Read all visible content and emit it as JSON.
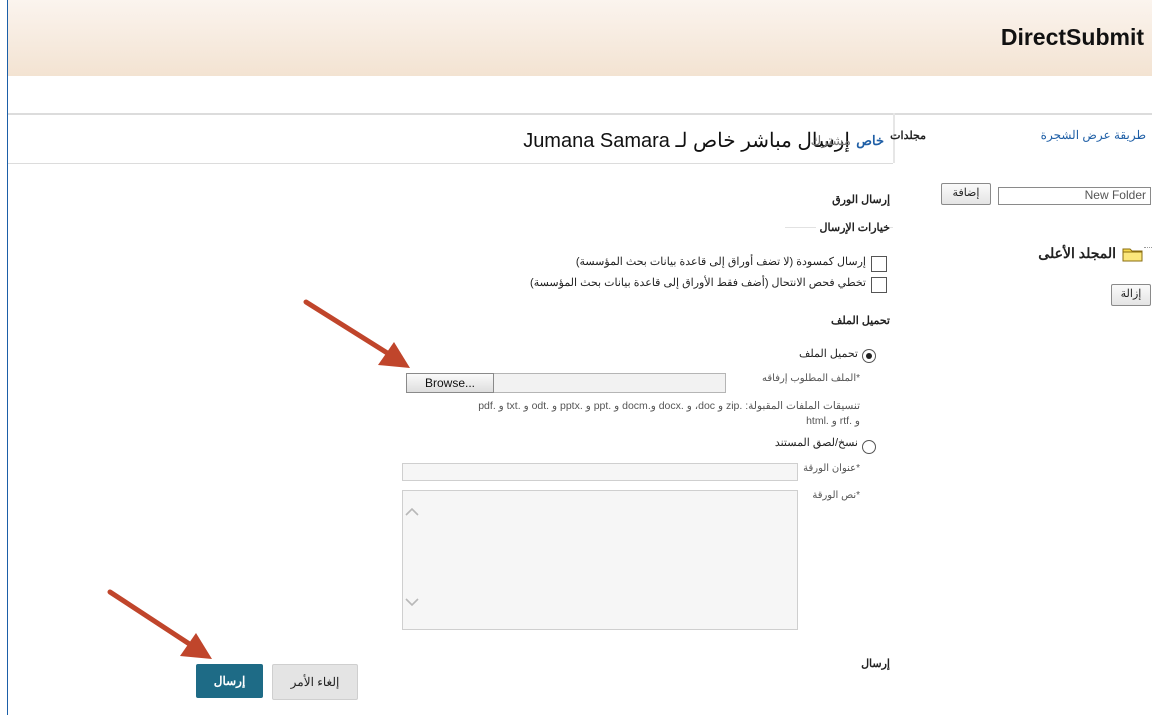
{
  "app": {
    "title": "DirectSubmit"
  },
  "header": {
    "heading": "إرسال مباشر خاص لـ Jumana Samara",
    "tab_private": "خاص",
    "tab_shared": "مشترك",
    "folders_label": "مجلدات",
    "tree_view_link": "طريقة عرض الشجرة"
  },
  "folders": {
    "new_folder_value": "New Folder",
    "add_label": "إضافة",
    "top_folder_label": "المجلد الأعلى",
    "remove_label": "إزالة"
  },
  "form": {
    "submit_paper_heading": "إرسال الورق",
    "submit_options_heading": "خيارات الإرسال",
    "option_draft": "إرسال كمسودة (لا تضف أوراق إلى قاعدة بيانات بحث المؤسسة)",
    "option_skip_plagiarism": "تخطي فحص الانتحال (أضف فقط الأوراق إلى قاعدة بيانات بحث المؤسسة)",
    "file_upload_heading": "تحميل الملف",
    "radio_upload_label": "تحميل الملف",
    "required_file_label": "*الملف المطلوب إرفاقه",
    "browse_label": "Browse...",
    "accepted_formats_line1": "تنسيقات الملفات المقبولة: .zip و doc، و .docx و.docm و .ppt و .pptx و .odt و .txt و .pdf",
    "accepted_formats_line2": "و .rtf و .html",
    "radio_paste_label": "نسخ/لصق المستند",
    "paper_title_label": "*عنوان الورقة",
    "paper_text_label": "*نص الورقة",
    "submit_section_label": "إرسال"
  },
  "actions": {
    "submit_label": "إرسال",
    "cancel_label": "إلغاء الأمر"
  },
  "colors": {
    "submit_button": "#1e6b86",
    "link": "#1f5fa6",
    "arrow": "#c0452b"
  }
}
